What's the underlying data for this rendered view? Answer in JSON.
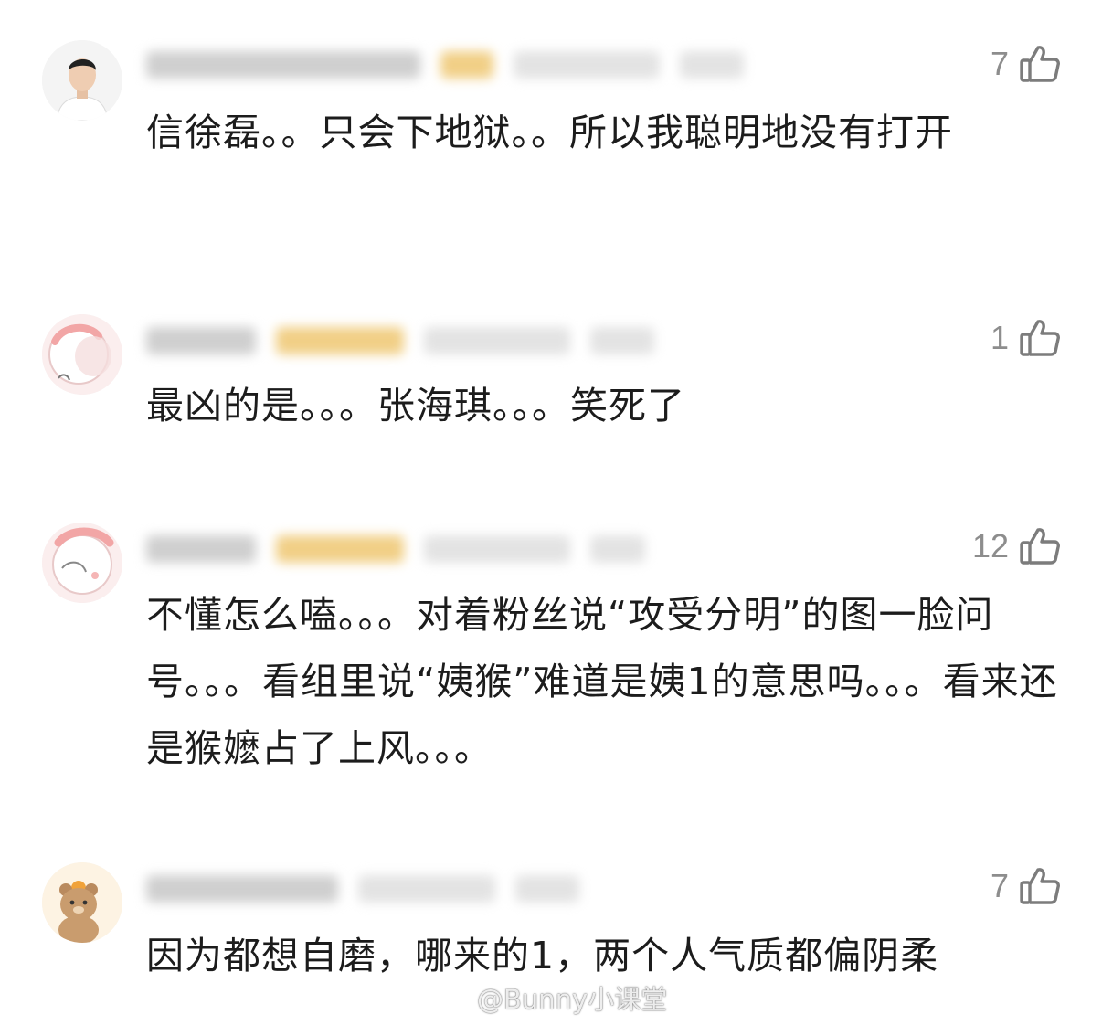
{
  "comments": [
    {
      "likes": "7",
      "text": "信徐磊。。只会下地狱。。所以我聪明地没有打开",
      "avatar_icon": "man-portrait-avatar"
    },
    {
      "likes": "1",
      "text": "最凶的是。。。张海琪。。。笑死了",
      "avatar_icon": "pink-cartoon-avatar"
    },
    {
      "likes": "12",
      "text": "不懂怎么嗑。。。对着粉丝说“攻受分明”的图一脸问号。。。看组里说“姨猴”难道是姨1的意思吗。。。看来还是猴嬷占了上风。。。",
      "avatar_icon": "pink-cartoon-avatar"
    },
    {
      "likes": "7",
      "text": "因为都想自磨，哪来的1，两个人气质都偏阴柔",
      "avatar_icon": "bear-cartoon-avatar"
    }
  ],
  "watermark": {
    "text": "@Bunny小课堂",
    "icon": "weibo-logo-icon"
  },
  "colors": {
    "text": "#1c1c1c",
    "muted": "#8d8d8d",
    "background": "#ffffff"
  }
}
